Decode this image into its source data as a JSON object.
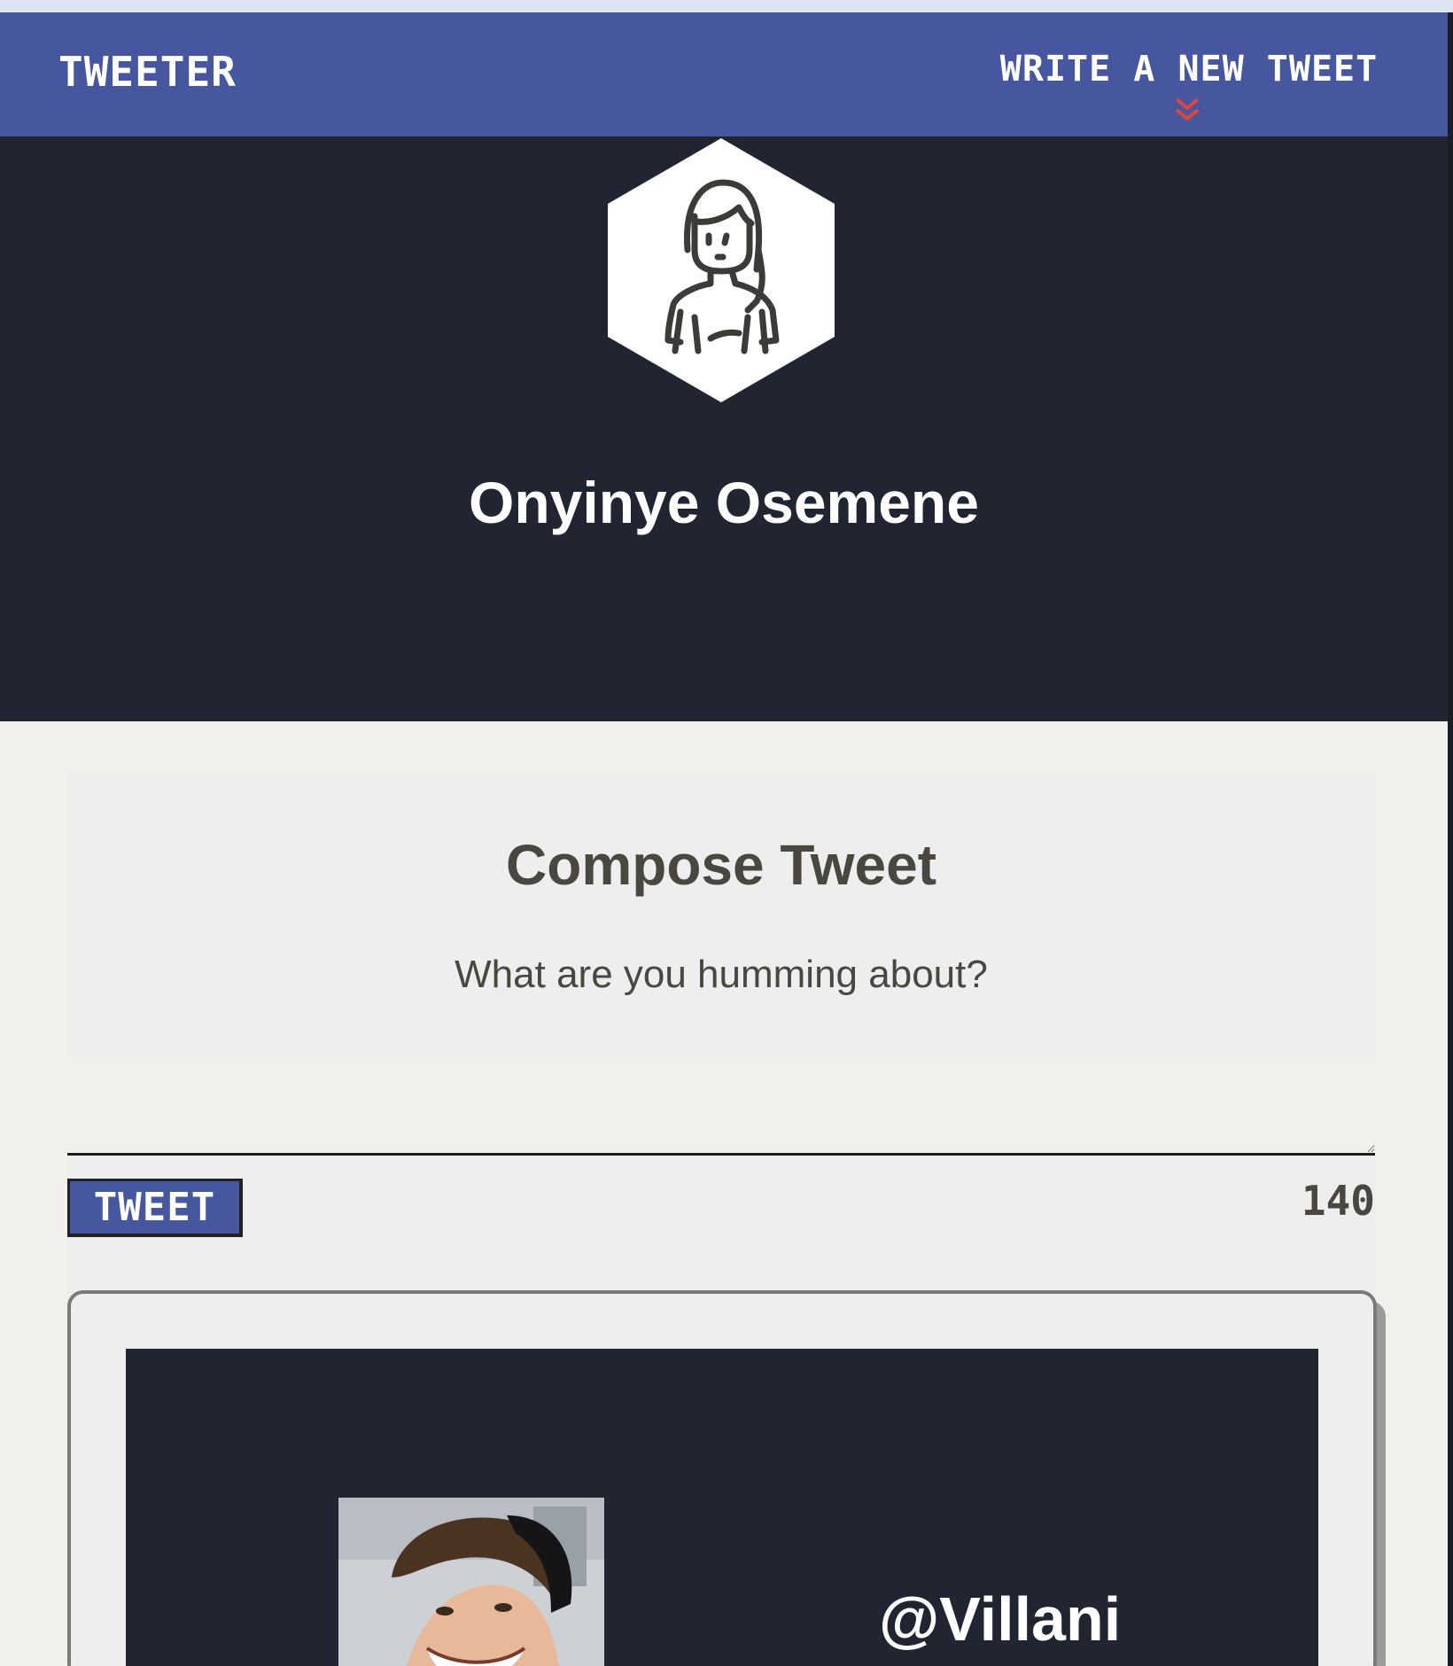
{
  "navbar": {
    "brand": "TWEETER",
    "write_new_tweet": "WRITE A NEW TWEET",
    "chevron_icon": "double-chevron-down-icon"
  },
  "profile": {
    "name": "Onyinye Osemene",
    "avatar_icon": "woman-avatar-icon"
  },
  "compose": {
    "title": "Compose Tweet",
    "prompt": "What are you humming about?",
    "textarea_value": "",
    "button_label": "TWEET",
    "char_count": "140"
  },
  "tweets": [
    {
      "handle": "@Villani"
    }
  ],
  "colors": {
    "navbar_bg": "#4657a0",
    "hero_bg": "#212431",
    "page_bg": "#f2f0ed",
    "compose_bg": "#efedee",
    "chevron": "#e0453a",
    "text_dark": "#4a4741"
  }
}
